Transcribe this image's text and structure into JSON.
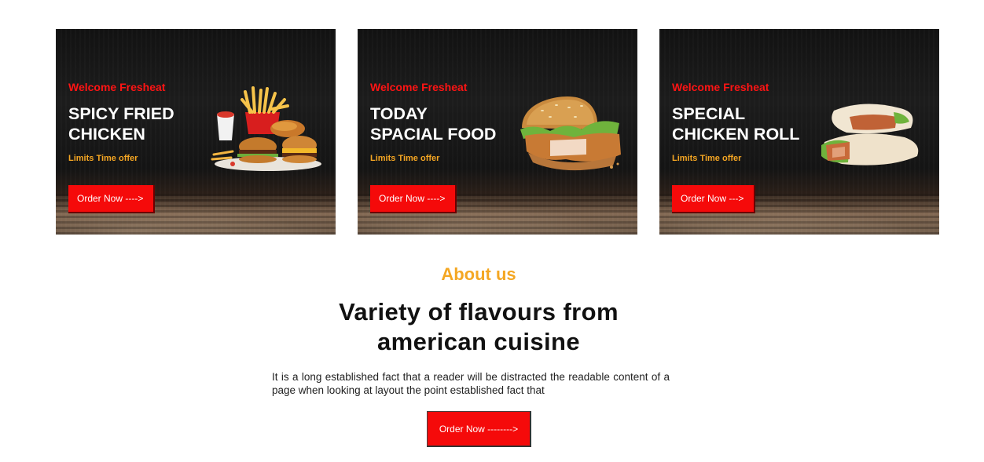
{
  "cards": [
    {
      "welcome": "Welcome Fresheat",
      "title_line1": "SPICY FRIED",
      "title_line2": "CHICKEN",
      "offer": "Limits Time offer",
      "button": "Order Now ---->",
      "image": "burger-fries-combo-image"
    },
    {
      "welcome": "Welcome Fresheat",
      "title_line1": "TODAY",
      "title_line2": "SPACIAL FOOD",
      "offer": "Limits Time offer",
      "button": "Order Now ---->",
      "image": "chicken-burger-image"
    },
    {
      "welcome": "Welcome Fresheat",
      "title_line1": "SPECIAL",
      "title_line2": "CHICKEN ROLL",
      "offer": "Limits Time offer",
      "button": "Order Now --->",
      "image": "chicken-wrap-image"
    }
  ],
  "about": {
    "subtitle": "About us",
    "title_line1": "Variety of flavours from",
    "title_line2": "american cuisine",
    "text": "It is a long established fact that a reader will be distracted the readable content of a page when looking at layout the point established fact that",
    "button": "Order Now -------->"
  },
  "colors": {
    "accent_red": "#f50a0a",
    "accent_orange": "#f4a723",
    "card_bg": "#141414"
  }
}
